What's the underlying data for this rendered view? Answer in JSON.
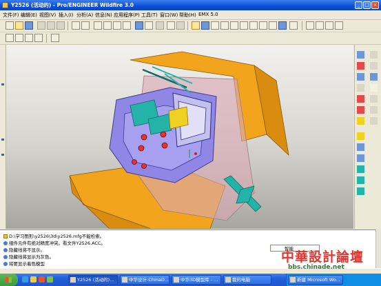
{
  "window": {
    "title": "Y2526 (活动的) - Pro/ENGINEER Wildfire 3.0"
  },
  "menu": [
    "文件(F)",
    "编辑(E)",
    "视图(V)",
    "插入(I)",
    "分析(A)",
    "信息(N)",
    "应用程序(P)",
    "工具(T)",
    "窗口(W)",
    "帮助(H)",
    "EMX 5.0"
  ],
  "messages": [
    {
      "icon": "warning-icon",
      "text": "D:\\学习图形\\y2526\\3d\\y2526.mfg不能检索。"
    },
    {
      "icon": "info-icon",
      "text": "组件元件有绝对精度冲突。看文件Y2526.ACC。"
    },
    {
      "icon": "bullet",
      "text": "隐藏线将不显示。"
    },
    {
      "icon": "bullet",
      "text": "隐藏线将显示为灰色。"
    },
    {
      "icon": "bullet",
      "text": "将要显示着色模型"
    }
  ],
  "smart_filter": "智能",
  "watermark": {
    "title": "中華設計論壇",
    "url": "bbs.chinade.net"
  },
  "taskbar": {
    "items": [
      {
        "label": "Y2526 (活动的)...",
        "active": true
      },
      {
        "label": "中华设计-ChinaD...",
        "active": false
      },
      {
        "label": "中华3D模型库 - ...",
        "active": false
      },
      {
        "label": "我的电脑",
        "active": false
      },
      {
        "label": "新建 Microsoft Wo...",
        "active": false
      }
    ]
  },
  "colors": {
    "mold_base": "#f2a51c",
    "cavity": "#8f86e6",
    "teal_parts": "#23b3a8",
    "yellow_block": "#f0d020",
    "screws": "#e8322a",
    "transparent_plate": "#d8a6b4"
  }
}
